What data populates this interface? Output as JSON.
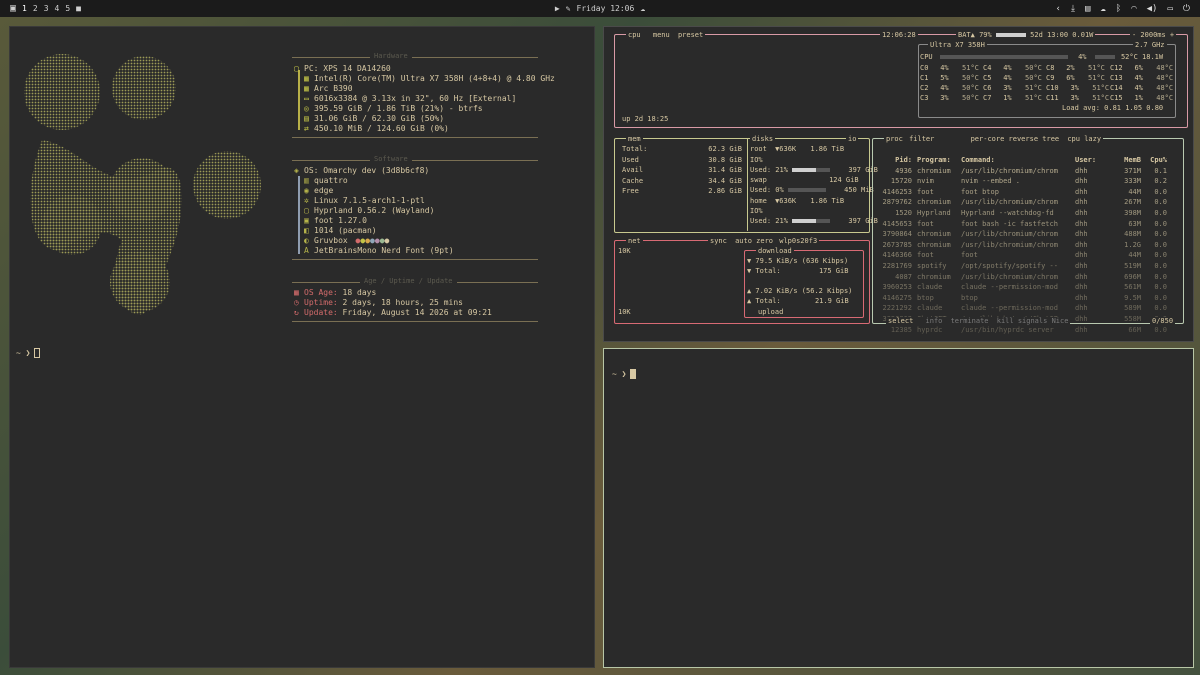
{
  "topbar": {
    "workspaces": [
      "1",
      "2",
      "3",
      "4",
      "5"
    ],
    "active_workspace": "1",
    "clock": "Friday 12:06"
  },
  "left_terminal": {
    "prompt": "~ ❯"
  },
  "fastfetch": {
    "hardware_title": "Hardware",
    "hardware": [
      {
        "icon": "",
        "text": "PC: XPS 14 DA14260"
      },
      {
        "icon": "",
        "text": "Intel(R) Core(TM) Ultra X7 358H (4+8+4) @ 4.80 GHz"
      },
      {
        "icon": "",
        "text": "Arc B390"
      },
      {
        "icon": "",
        "text": "6016x3384 @ 3.13x in 32\", 60 Hz [External]"
      },
      {
        "icon": "",
        "text": "395.59 GiB / 1.86 TiB (21%) - btrfs"
      },
      {
        "icon": "",
        "text": "31.06 GiB / 62.30 GiB (50%)"
      },
      {
        "icon": "",
        "text": "450.10 MiB / 124.60 GiB (0%)"
      }
    ],
    "software_title": "Software",
    "software": [
      {
        "icon": "",
        "text": "OS: Omarchy dev (3d8b6cf8)"
      },
      {
        "icon": "",
        "text": "quattro"
      },
      {
        "icon": "",
        "text": "edge"
      },
      {
        "icon": "",
        "text": "Linux 7.1.5-arch1-1-ptl"
      },
      {
        "icon": "",
        "text": "Hyprland 0.56.2 (Wayland)"
      },
      {
        "icon": "",
        "text": "foot 1.27.0"
      },
      {
        "icon": "",
        "text": "1014 (pacman)"
      },
      {
        "icon": "",
        "text": "Gruvbox"
      },
      {
        "icon": "",
        "text": "JetBrainsMono Nerd Font (9pt)"
      }
    ],
    "age_title": "Age / Uptime / Update",
    "age": [
      {
        "icon": "",
        "key": "OS Age:",
        "text": "18 days"
      },
      {
        "icon": "",
        "key": "Uptime:",
        "text": "2 days, 18 hours, 25 mins"
      },
      {
        "icon": "",
        "key": "Update:",
        "text": "Friday, August 14 2026 at 09:21"
      }
    ]
  },
  "btop": {
    "cpu_label": "cpu",
    "menu_label": "menu",
    "preset_label": "preset",
    "time": "12:06:28",
    "battery": "BAT▲ 79%",
    "battery_time": "52d 13:00 0.01W",
    "refresh": "- 2000ms +",
    "cpu_model": "Ultra X7 358H",
    "cpu_freq": "2.7 GHz",
    "cpu_total_label": "CPU",
    "cpu_total_pct": "4%",
    "cpu_total_temp": "52°C 18.1W",
    "cores": [
      [
        "C0",
        "4%",
        "51°C"
      ],
      [
        "C4",
        "4%",
        "50°C"
      ],
      [
        "C8",
        "2%",
        "51°C"
      ],
      [
        "C12",
        "6%",
        "48°C"
      ],
      [
        "C1",
        "5%",
        "50°C"
      ],
      [
        "C5",
        "4%",
        "50°C"
      ],
      [
        "C9",
        "6%",
        "51°C"
      ],
      [
        "C13",
        "4%",
        "48°C"
      ],
      [
        "C2",
        "4%",
        "50°C"
      ],
      [
        "C6",
        "3%",
        "51°C"
      ],
      [
        "C10",
        "3%",
        "51°C"
      ],
      [
        "C14",
        "4%",
        "48°C"
      ],
      [
        "C3",
        "3%",
        "50°C"
      ],
      [
        "C7",
        "1%",
        "51°C"
      ],
      [
        "C11",
        "3%",
        "51°C"
      ],
      [
        "C15",
        "1%",
        "48°C"
      ]
    ],
    "load_avg": "Load avg:  0.81  1.05  0.80",
    "uptime": "up 2d 18:25",
    "mem_label": "mem",
    "mem": [
      {
        "k": "Total:",
        "v": "62.3 GiB"
      },
      {
        "k": "Used",
        "v": "30.8 GiB"
      },
      {
        "k": "Avail",
        "v": "31.4 GiB"
      },
      {
        "k": "Cache",
        "v": "34.4 GiB"
      },
      {
        "k": "Free",
        "v": "2.86 GiB"
      }
    ],
    "disks_label": "disks",
    "io_label": "io",
    "root_label": "root",
    "root_io": "▼636K",
    "root_size": "1.86 TiB",
    "root_io_pct": "IO%",
    "root_used": "Used: 21%",
    "root_used_val": "397 GiB",
    "swap_label": "swap",
    "swap_size": "124 GiB",
    "swap_used": "Used:  0%",
    "swap_used_val": "450 MiB",
    "home_label": "home",
    "home_io": "▼636K",
    "home_size": "1.86 TiB",
    "home_io_pct": "IO%",
    "home_used": "Used: 21%",
    "home_used_val": "397 GiB",
    "net_label": "net",
    "sync_label": "sync",
    "auto_label": "auto",
    "zero_label": "zero",
    "iface": "wlp0s20f3",
    "net_scale_top": "10K",
    "net_scale_bottom": "10K",
    "download_label": "download",
    "download_rate": "▼ 79.5 KiB/s",
    "download_kbps": "(636 Kibps)",
    "download_total_label": "▼ Total:",
    "download_total": "175 GiB",
    "upload_rate": "▲ 7.02 KiB/s",
    "upload_kbps": "(56.2 Kibps)",
    "upload_total_label": "▲ Total:",
    "upload_total": "21.9 GiB",
    "upload_label": "upload",
    "proc_label": "proc",
    "filter_label": "filter",
    "percore_label": "per-core",
    "reverse_label": "reverse",
    "tree_label": "tree",
    "sort_label": "cpu lazy",
    "proc_headers": [
      "Pid:",
      "Program:",
      "Command:",
      "User:",
      "MemB",
      "Cpu%"
    ],
    "processes": [
      [
        "4936",
        "chromium",
        "/usr/lib/chromium/chrom",
        "dhh",
        "371M",
        "0.1"
      ],
      [
        "15720",
        "nvim",
        "nvim --embed .",
        "dhh",
        "333M",
        "0.2"
      ],
      [
        "4146253",
        "foot",
        "foot btop",
        "dhh",
        "44M",
        "0.0"
      ],
      [
        "2879762",
        "chromium",
        "/usr/lib/chromium/chrom",
        "dhh",
        "267M",
        "0.0"
      ],
      [
        "1520",
        "Hyprland",
        "Hyprland --watchdog-fd",
        "dhh",
        "398M",
        "0.0"
      ],
      [
        "4145653",
        "foot",
        "foot bash -ic fastfetch",
        "dhh",
        "63M",
        "0.0"
      ],
      [
        "3790864",
        "chromium",
        "/usr/lib/chromium/chrom",
        "dhh",
        "488M",
        "0.0"
      ],
      [
        "2673785",
        "chromium",
        "/usr/lib/chromium/chrom",
        "dhh",
        "1.2G",
        "0.0"
      ],
      [
        "4146366",
        "foot",
        "foot",
        "dhh",
        "44M",
        "0.0"
      ],
      [
        "2281769",
        "spotify",
        "/opt/spotify/spotify --",
        "dhh",
        "519M",
        "0.0"
      ],
      [
        "4087",
        "chromium",
        "/usr/lib/chromium/chrom",
        "dhh",
        "696M",
        "0.0"
      ],
      [
        "3960253",
        "claude",
        "claude --permission-mod",
        "dhh",
        "561M",
        "0.0"
      ],
      [
        "4146275",
        "btop",
        "btop",
        "dhh",
        "9.5M",
        "0.0"
      ],
      [
        "2221292",
        "claude",
        "claude --permission-mod",
        "dhh",
        "589M",
        "0.0"
      ],
      [
        "3836862",
        "ChatGPT",
        "/usr/lib/chatgpt/ChatGP",
        "dhh",
        "558M",
        "0.0"
      ],
      [
        "12385",
        "hyprdc",
        "/usr/bin/hyprdc server",
        "dhh",
        "66M",
        "0.0"
      ]
    ],
    "footer_select": "select",
    "footer_info": "info",
    "footer_terminate": "terminate",
    "footer_kill": "kill",
    "footer_signals": "signals",
    "footer_nice": "Nice",
    "footer_count": "0/850"
  },
  "right_terminal": {
    "prompt": "~ ❯"
  },
  "colors": {
    "accent_yellow": "#c2c347",
    "accent_red": "#d36b6b",
    "btop_cpu_border": "#d99aa6",
    "btop_mem_border": "#c8c98f",
    "btop_net_border": "#d86a74",
    "btop_proc_border": "#b9c9b0"
  }
}
